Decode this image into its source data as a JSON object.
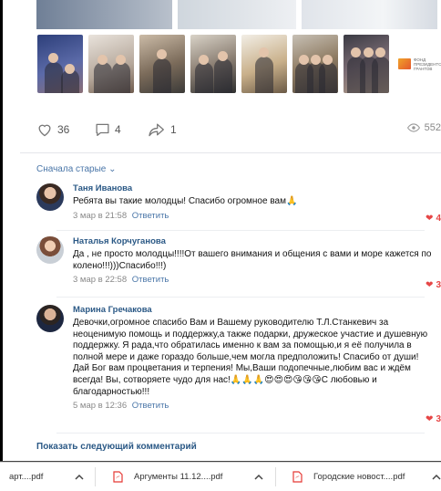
{
  "post": {
    "likes": "36",
    "comments": "4",
    "shares": "1",
    "views": "552"
  },
  "sort_label": "Сначала старые",
  "comments": [
    {
      "author": "Таня Иванова",
      "text": "Ребята вы такие молодцы! Спасибо огромное вам🙏",
      "date": "3 мар в 21:58",
      "reply": "Ответить",
      "likes": "4"
    },
    {
      "author": "Наталья Корчуганова",
      "text": "Да , не просто молодцы!!!!От вашего внимания и общения с вами и море кажется по колено!!!)))Спасибо!!!)",
      "date": "3 мар в 22:58",
      "reply": "Ответить",
      "likes": "3"
    },
    {
      "author": "Марина Гречакова",
      "text": "Девочки,огромное спасибо Вам и Вашему руководителю Т.Л.Станкевич за неоценимую помощь и поддержку,а также подарки, дружеское участие и душевную поддержку. Я рада,что обратилась именно к вам за помощью,и я её получила в полной мере и даже гораздо больше,чем могла предположить! Спасибо от души! Дай Бог вам процветания и терпения! Мы,Ваши подопечные,любим вас и ждём всегда! Вы, сотворяете чудо для нас!🙏🙏🙏😍😍😍😘😘😘С любовью и благодарностью!!!",
      "date": "5 мар в 12:36",
      "reply": "Ответить",
      "likes": "3"
    }
  ],
  "show_more": "Показать следующий комментарий",
  "fund_logo_text": "ФОНД ПРЕЗИДЕНТСКИХ ГРАНТОВ",
  "downloads": [
    {
      "name": "арт....pdf"
    },
    {
      "name": "Аргументы 11.12....pdf"
    },
    {
      "name": "Городские новост....pdf"
    }
  ],
  "colors": {
    "link": "#2a5885",
    "accent": "#4a76a8",
    "like": "#e64646",
    "pdf": "#e53935"
  }
}
